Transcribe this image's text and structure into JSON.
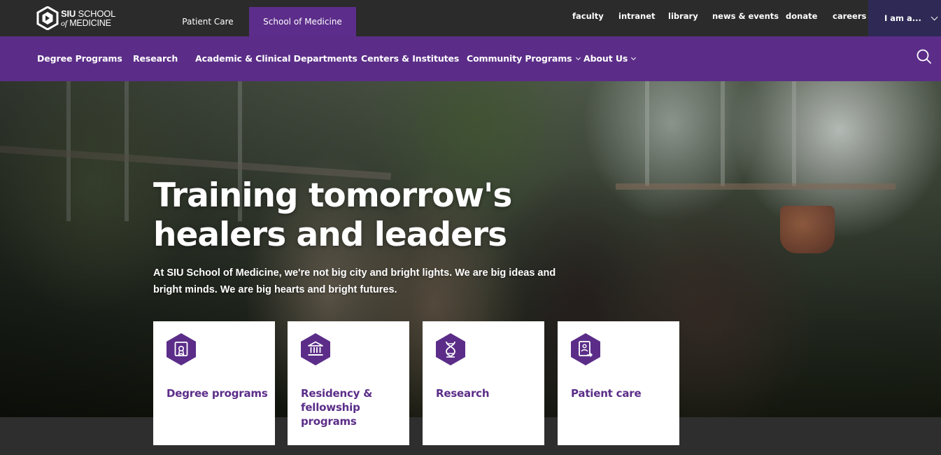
{
  "logo": {
    "line1_bold": "SIU",
    "line1_rest": "SCHOOL",
    "line2_small": "of",
    "line2_rest": "MEDICINE"
  },
  "site_tabs": [
    {
      "label": "Patient Care",
      "active": false
    },
    {
      "label": "School of Medicine",
      "active": true
    }
  ],
  "utility_links": [
    "faculty",
    "intranet",
    "library",
    "news & events",
    "donate",
    "careers"
  ],
  "iam_dropdown": {
    "label": "I am a..."
  },
  "main_nav": [
    {
      "label": "Degree Programs",
      "has_dropdown": false
    },
    {
      "label": "Research",
      "has_dropdown": false
    },
    {
      "label": "Academic & Clinical Departments",
      "has_dropdown": false
    },
    {
      "label": "Centers & Institutes",
      "has_dropdown": false
    },
    {
      "label": "Community Programs",
      "has_dropdown": true
    },
    {
      "label": "About Us",
      "has_dropdown": true
    }
  ],
  "search": {
    "icon": "search-icon"
  },
  "hero": {
    "title_line1": "Training tomorrow's",
    "title_line2": "healers and leaders",
    "subtitle": "At SIU School of Medicine, we're not big city and bright lights. We are big ideas and bright minds. We are big hearts and bright futures."
  },
  "cards": [
    {
      "label": "Degree programs",
      "icon": "diploma-icon"
    },
    {
      "label": "Residency & fellowship programs",
      "icon": "institution-icon"
    },
    {
      "label": "Research",
      "icon": "dna-icon"
    },
    {
      "label": "Patient care",
      "icon": "patient-chart-icon"
    }
  ],
  "colors": {
    "brand_purple": "#5b2d88",
    "topbar": "#2b2b2b",
    "iam_bg": "#2e2a55",
    "card_text": "#5b2d88"
  }
}
